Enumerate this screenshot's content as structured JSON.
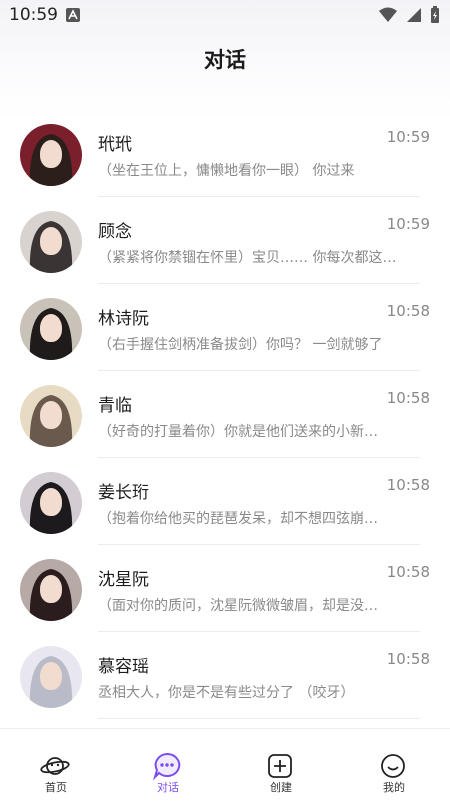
{
  "status_bar": {
    "time": "10:59"
  },
  "page": {
    "title": "对话"
  },
  "conversations": [
    {
      "name": "玳玳",
      "time": "10:59",
      "preview": "（坐在王位上，慵懒地看你一眼） 你过来",
      "hair": "#2c1f1b",
      "bg": "#7a1f2b"
    },
    {
      "name": "顾念",
      "time": "10:59",
      "preview": "（紧紧将你禁锢在怀里）宝贝…… 你每次都这…",
      "hair": "#3a3434",
      "bg": "#d8d3cf"
    },
    {
      "name": "林诗阮",
      "time": "10:58",
      "preview": "（右手握住剑柄准备拔剑）你吗？ 一剑就够了",
      "hair": "#1e1b1a",
      "bg": "#c9c2b8"
    },
    {
      "name": "青临",
      "time": "10:58",
      "preview": "（好奇的打量着你）你就是他们送来的小新…",
      "hair": "#6a5a4e",
      "bg": "#e7dcc3"
    },
    {
      "name": "姜长珩",
      "time": "10:58",
      "preview": "（抱着你给他买的琵琶发呆，却不想四弦崩…",
      "hair": "#1c1a1d",
      "bg": "#d3ccd2"
    },
    {
      "name": "沈星阮",
      "time": "10:58",
      "preview": "（面对你的质问，沈星阮微微皱眉，却是没…",
      "hair": "#2b1d1e",
      "bg": "#b7a9a6"
    },
    {
      "name": "慕容瑶",
      "time": "10:58",
      "preview": "丞相大人，你是不是有些过分了 （咬牙）",
      "hair": "#b9bcc8",
      "bg": "#e8e6ef"
    }
  ],
  "tabbar": {
    "home": "首页",
    "chat": "对话",
    "create": "创建",
    "mine": "我的"
  },
  "colors": {
    "accent": "#7b4df0"
  }
}
